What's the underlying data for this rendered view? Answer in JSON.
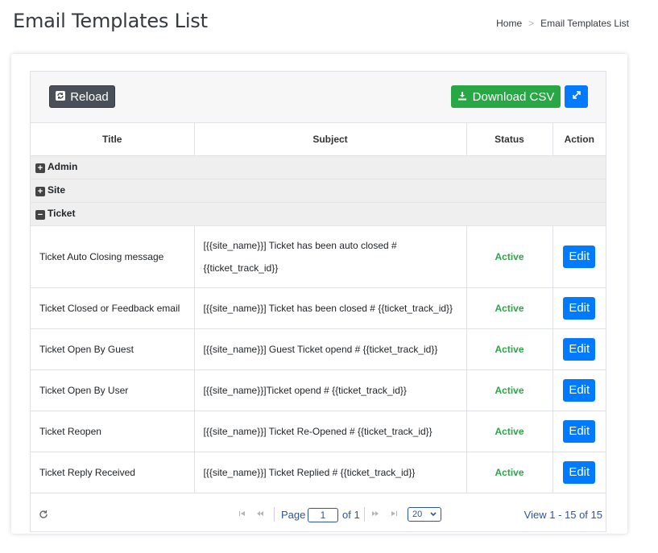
{
  "header": {
    "title": "Email Templates List",
    "breadcrumb": {
      "home": "Home",
      "separator": ">",
      "current": "Email Templates List"
    }
  },
  "toolbar": {
    "reload_label": "Reload",
    "csv_label": "Download CSV"
  },
  "table": {
    "columns": [
      "Title",
      "Subject",
      "Status",
      "Action"
    ],
    "groups": [
      {
        "label": "Admin",
        "toggle": "+"
      },
      {
        "label": "Site",
        "toggle": "+"
      },
      {
        "label": "Ticket",
        "toggle": "−"
      }
    ],
    "rows": [
      {
        "title": "Ticket Auto Closing message",
        "subject": "[{{site_name}}]  Ticket has been auto closed # {{ticket_track_id}}",
        "status": "Active",
        "action": "Edit"
      },
      {
        "title": "Ticket Closed or Feedback email",
        "subject": "[{{site_name}}]  Ticket has been closed # {{ticket_track_id}}",
        "status": "Active",
        "action": "Edit"
      },
      {
        "title": "Ticket Open By Guest",
        "subject": "[{{site_name}}] Guest Ticket opend # {{ticket_track_id}}",
        "status": "Active",
        "action": "Edit"
      },
      {
        "title": "Ticket Open By User",
        "subject": "[{{site_name}}]Ticket opend # {{ticket_track_id}}",
        "status": "Active",
        "action": "Edit"
      },
      {
        "title": "Ticket Reopen",
        "subject": "[{{site_name}}]  Ticket Re-Opened # {{ticket_track_id}}",
        "status": "Active",
        "action": "Edit"
      },
      {
        "title": "Ticket Reply Received",
        "subject": "[{{site_name}}] Ticket Replied # {{ticket_track_id}}",
        "status": "Active",
        "action": "Edit"
      }
    ]
  },
  "pager": {
    "page_label": "Page",
    "page_value": "1",
    "of_label": "of 1",
    "rows_per_page": "20",
    "view_text": "View 1 - 15 of 15"
  },
  "colors": {
    "active": "#28a745",
    "primary": "#007bff",
    "pager_text": "#2b5797"
  },
  "icons": [
    "refresh-icon",
    "download-icon",
    "expand-icon",
    "plus-square-icon",
    "minus-square-icon",
    "first-page-icon",
    "prev-page-icon",
    "next-page-icon",
    "last-page-icon",
    "chevron-down-icon"
  ]
}
